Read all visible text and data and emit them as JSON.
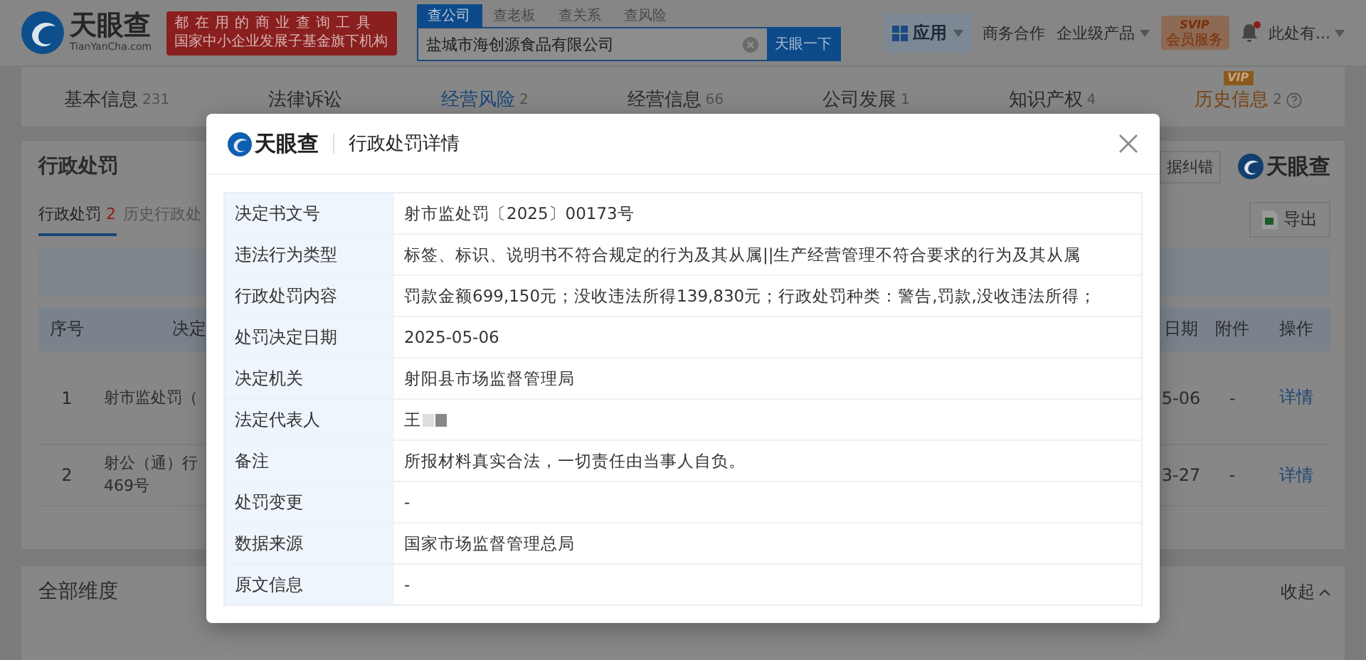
{
  "header": {
    "logo": {
      "name": "天眼查",
      "domain": "TianYanCha.com"
    },
    "slogan": [
      "都在用的商业查询工具",
      "国家中小企业发展子基金旗下机构"
    ],
    "search_tabs": [
      {
        "label": "查公司",
        "selected": true
      },
      {
        "label": "查老板",
        "selected": false
      },
      {
        "label": "查关系",
        "selected": false
      },
      {
        "label": "查风险",
        "selected": false
      }
    ],
    "search": {
      "value": "盐城市海创源食品有限公司",
      "button": "天眼一下"
    },
    "nav": [
      {
        "kind": "app",
        "label": "应用"
      },
      {
        "kind": "link",
        "label": "商务合作"
      },
      {
        "kind": "dropdown",
        "label": "企业级产品"
      },
      {
        "kind": "badge",
        "label": "SVIP",
        "sublabel": "会员服务"
      },
      {
        "kind": "bell",
        "unread": true
      },
      {
        "kind": "dropdown",
        "label": "此处有..."
      }
    ]
  },
  "tabs": [
    {
      "label": "基本信息",
      "count": "231",
      "selected": false
    },
    {
      "label": "法律诉讼",
      "selected": false
    },
    {
      "label": "经营风险",
      "count": "2",
      "selected": true
    },
    {
      "label": "经营信息",
      "count": "66",
      "selected": false
    },
    {
      "label": "公司发展",
      "count": "1",
      "selected": false
    },
    {
      "label": "知识产权",
      "count": "4",
      "selected": false
    },
    {
      "label": "历史信息",
      "count": "2",
      "selected": false,
      "badge": "VIP",
      "help": true
    }
  ],
  "section": {
    "title": "行政处罚",
    "report_button": "据纠错",
    "brand": "天眼查",
    "subtabs": [
      {
        "label": "行政处罚",
        "count": "2",
        "selected": true
      },
      {
        "label": "历史行政处",
        "selected": false
      }
    ],
    "export_button": "导出",
    "table": {
      "columns_left": [
        "序号",
        "决定"
      ],
      "columns_right": [
        "日期",
        "附件",
        "操作"
      ],
      "rows": [
        {
          "index": "1",
          "doc": [
            "射市监处罚（"
          ],
          "date": "5-06",
          "attachment": "-",
          "action": "详情"
        },
        {
          "index": "2",
          "doc": [
            "射公（通）行",
            "469号"
          ],
          "date": "3-27",
          "attachment": "-",
          "action": "详情"
        }
      ]
    }
  },
  "dimensions": {
    "title": "全部维度",
    "collapse": "收起"
  },
  "modal": {
    "brand": "天眼查",
    "title": "行政处罚详情",
    "rows": [
      {
        "label": "决定书文号",
        "value": "射市监处罚〔2025〕00173号"
      },
      {
        "label": "违法行为类型",
        "value": "标签、标识、说明书不符合规定的行为及其从属||生产经营管理不符合要求的行为及其从属"
      },
      {
        "label": "行政处罚内容",
        "value": "罚款金额699,150元；没收违法所得139,830元；行政处罚种类：警告,罚款,没收违法所得；"
      },
      {
        "label": "处罚决定日期",
        "value": "2025-05-06"
      },
      {
        "label": "决定机关",
        "value": "射阳县市场监督管理局"
      },
      {
        "label": "法定代表人",
        "value": "王",
        "redacted": true
      },
      {
        "label": "备注",
        "value": "所报材料真实合法，一切责任由当事人自负。"
      },
      {
        "label": "处罚变更",
        "value": "-"
      },
      {
        "label": "数据来源",
        "value": "国家市场监督管理总局"
      },
      {
        "label": "原文信息",
        "value": "-"
      }
    ]
  }
}
